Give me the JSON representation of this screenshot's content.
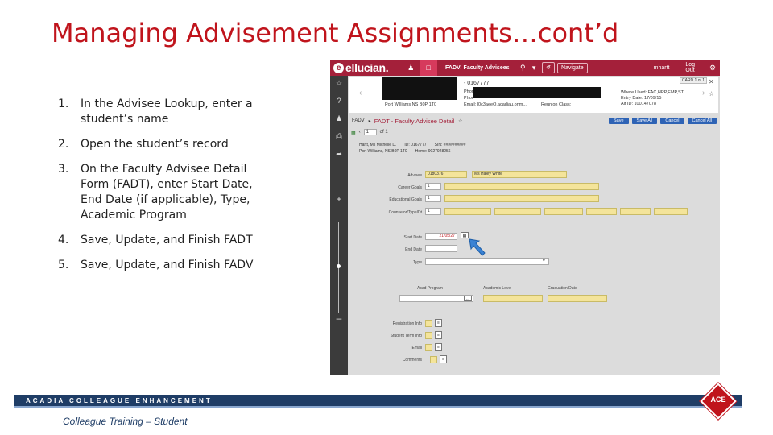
{
  "slide": {
    "title": "Managing Advisement Assignments…cont’d",
    "steps": [
      {
        "num": "1.",
        "text": "In the Advisee Lookup, enter a student’s name"
      },
      {
        "num": "2.",
        "text": "Open the student’s record"
      },
      {
        "num": "3.",
        "text": "On the Faculty Advisee Detail Form (FADT), enter Start Date, End Date (if applicable), Type, Academic Program"
      },
      {
        "num": "4.",
        "text": "Save, Update, and Finish FADT"
      },
      {
        "num": "5.",
        "text": "Save, Update, and Finish FADV"
      }
    ],
    "footer_band": "ACADIA COLLEAGUE ENHANCEMENT",
    "footer_caption": "Colleague Training – Student",
    "ace_logo": "ACE"
  },
  "app": {
    "brand": "ellucian.",
    "form_name": "FADV: Faculty Advisees",
    "navigate_label": "Navigate",
    "user": "mhartt",
    "logout": "Log Out",
    "card": {
      "id": "- 0167777",
      "phone1": "Phor",
      "phone2": "Phor",
      "email": "Email: l0c3aeeO.acadiau.onm...",
      "address": "Port Williams NS B0P 1T0",
      "reunion": "Reunion Class:",
      "where_used": "Where Used: FAC,HRP,EMP,ST...",
      "entry_date": "Entry Date: 17/09/15",
      "alt_id": "Alt ID: 100147078",
      "badge": "CARD 1 of 1"
    },
    "form_bar": {
      "crumb": "FADV",
      "title": "FADT - Faculty Advisee Detail",
      "save": "Save",
      "save_all": "Save All",
      "cancel": "Cancel",
      "cancel_all": "Cancel All"
    },
    "pager": {
      "value": "1",
      "of": "of 1"
    },
    "record": {
      "name": "Hartt, Ms Michelle D.",
      "id": "ID: 0167777",
      "sin": "SIN: ##########",
      "address": "Port Williams,  NS  B0P 1T0",
      "home": "Home: 9027928256"
    },
    "fields": {
      "advisee_label": "Advisee",
      "advisee_id": "0180376",
      "advisee_name": "Ms Haley White",
      "career_goals_label": "Career Goals",
      "career_goals_value": "1",
      "educational_goals_label": "Educational Goals",
      "educational_goals_value": "1",
      "counselor_label": "Counselor/Type/Dt",
      "counselor_value": "1",
      "start_date_label": "Start Date",
      "start_date_value": "21/05/27",
      "end_date_label": "End Date",
      "type_label": "Type",
      "acad_program_label": "Acad Program",
      "academic_level_label": "Academic Level",
      "graduation_date_label": "Graduation Date",
      "registration_info_label": "Registration Info",
      "student_term_info_label": "Student Term Info",
      "email_label": "Email",
      "comments_label": "Comments"
    },
    "icons": [
      "star-icon",
      "help-icon",
      "user-icon",
      "print-icon",
      "share-icon",
      "plus-icon",
      "minus-icon",
      "search-icon",
      "gear-icon",
      "close-icon",
      "doc-icon"
    ]
  }
}
